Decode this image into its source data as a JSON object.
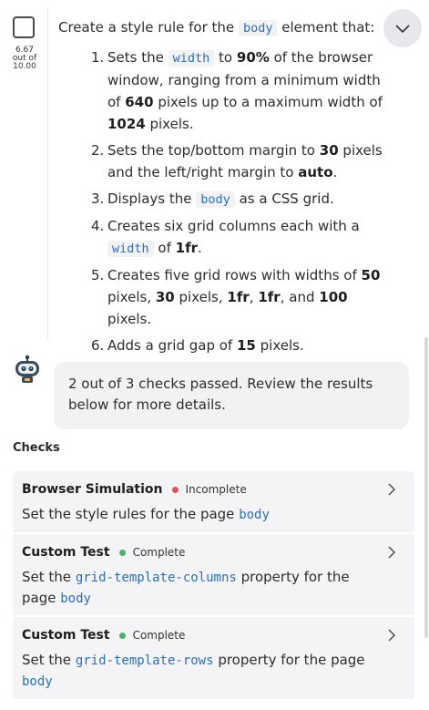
{
  "task": {
    "score_value": "6.67",
    "score_out_of": "out of",
    "score_max": "10.00",
    "intro_before": "Create a style rule for the",
    "intro_code": "body",
    "intro_after": "element that:",
    "steps": [
      {
        "num": "1.",
        "t1": "Sets the",
        "c1": "width",
        "t2": "to",
        "b1": "90%",
        "t3": "of the browser window, ranging from a minimum width of",
        "b2": "640",
        "t4": "pixels up to a maximum width of",
        "b3": "1024",
        "t5": "pixels."
      },
      {
        "num": "2.",
        "t1": "Sets the top/bottom margin to",
        "b1": "30",
        "t2": "pixels and the left/right margin to",
        "b2": "auto",
        "t3": "."
      },
      {
        "num": "3.",
        "t1": "Displays the",
        "c1": "body",
        "t2": "as a CSS grid."
      },
      {
        "num": "4.",
        "t1": "Creates six grid columns each with a",
        "c1": "width",
        "t2": "of",
        "b1": "1fr",
        "t3": "."
      },
      {
        "num": "5.",
        "t1": "Creates five grid rows with widths of",
        "b1": "50",
        "t2": "pixels,",
        "b2": "30",
        "t3": "pixels,",
        "b3": "1fr",
        "t4": ",",
        "b4": "1fr",
        "t5": ", and",
        "b5": "100",
        "t6": "pixels."
      },
      {
        "num": "6.",
        "t1": "Adds a grid gap of",
        "b1": "15",
        "t2": "pixels."
      }
    ]
  },
  "assistant": {
    "message": "2 out of 3 checks passed. Review the results below for more details."
  },
  "checks": {
    "title": "Checks",
    "items": [
      {
        "name": "Browser Simulation",
        "status": "Incomplete",
        "status_color": "#e0535d",
        "desc_before": "Set the style rules for the page",
        "desc_code": "body",
        "desc_mid": "",
        "desc_after": ""
      },
      {
        "name": "Custom Test",
        "status": "Complete",
        "status_color": "#4caf6e",
        "desc_before": "Set the",
        "desc_code": "grid-template-columns",
        "desc_mid": "property for the page",
        "desc_after": "body"
      },
      {
        "name": "Custom Test",
        "status": "Complete",
        "status_color": "#4caf6e",
        "desc_before": "Set the",
        "desc_code": "grid-template-rows",
        "desc_mid": "property for the page",
        "desc_after": "body"
      }
    ]
  },
  "icons": {
    "collapse": "chevron-down-icon",
    "check_chevron": "chevron-right-icon",
    "avatar": "robot-avatar-icon"
  }
}
